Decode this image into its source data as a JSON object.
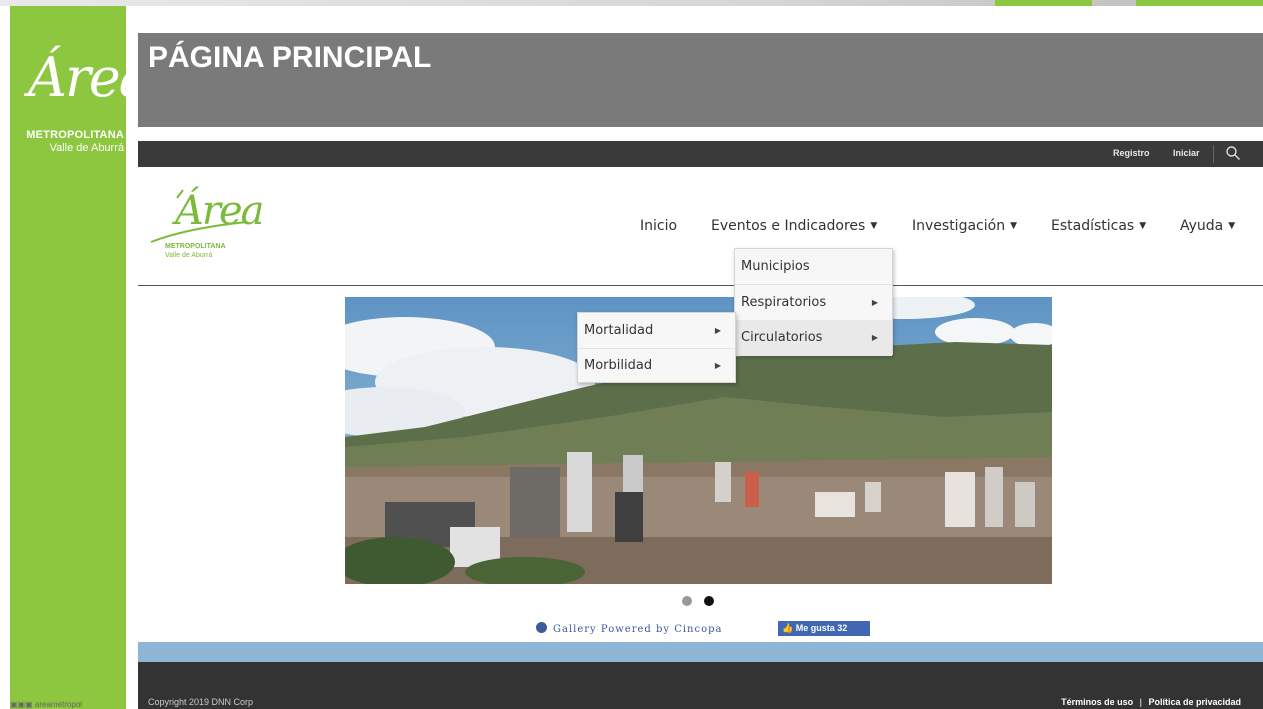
{
  "colors": {
    "sidebar_green": "#8dc63f",
    "header_gray": "#7a7a7a",
    "topbar_dark": "#3a3a3a",
    "footer_dark": "#333333",
    "blue_band": "#8eb4d6",
    "logo_green": "#7cba3b"
  },
  "sidebar": {
    "logo_script": "Área",
    "logo_line1": "METROPOLITANA",
    "logo_line2": "Valle de Aburrá",
    "social_text": "areametropol"
  },
  "header": {
    "title": "PÁGINA PRINCIPAL"
  },
  "topbar": {
    "registro": "Registro",
    "iniciar": "Iniciar",
    "search_icon": "search-icon"
  },
  "site_logo": {
    "script": "Área",
    "line1": "METROPOLITANA",
    "line2": "Valle de Aburrá"
  },
  "nav": {
    "inicio": "Inicio",
    "eventos": "Eventos e Indicadores",
    "investigacion": "Investigación",
    "estadisticas": "Estadísticas",
    "ayuda": "Ayuda"
  },
  "dropdown_main": {
    "items": [
      "Municipios",
      "Respiratorios",
      "Circulatorios"
    ]
  },
  "dropdown_sub": {
    "items": [
      "Mortalidad",
      "Morbilidad"
    ]
  },
  "gallery": {
    "credit": "Gallery Powered by Cincopa",
    "fb_like": "Me gusta 32"
  },
  "footer": {
    "copyright": "Copyright 2019 DNN Corp",
    "terms": "Términos de uso",
    "separator": "|",
    "privacy": "Política de privacidad"
  }
}
